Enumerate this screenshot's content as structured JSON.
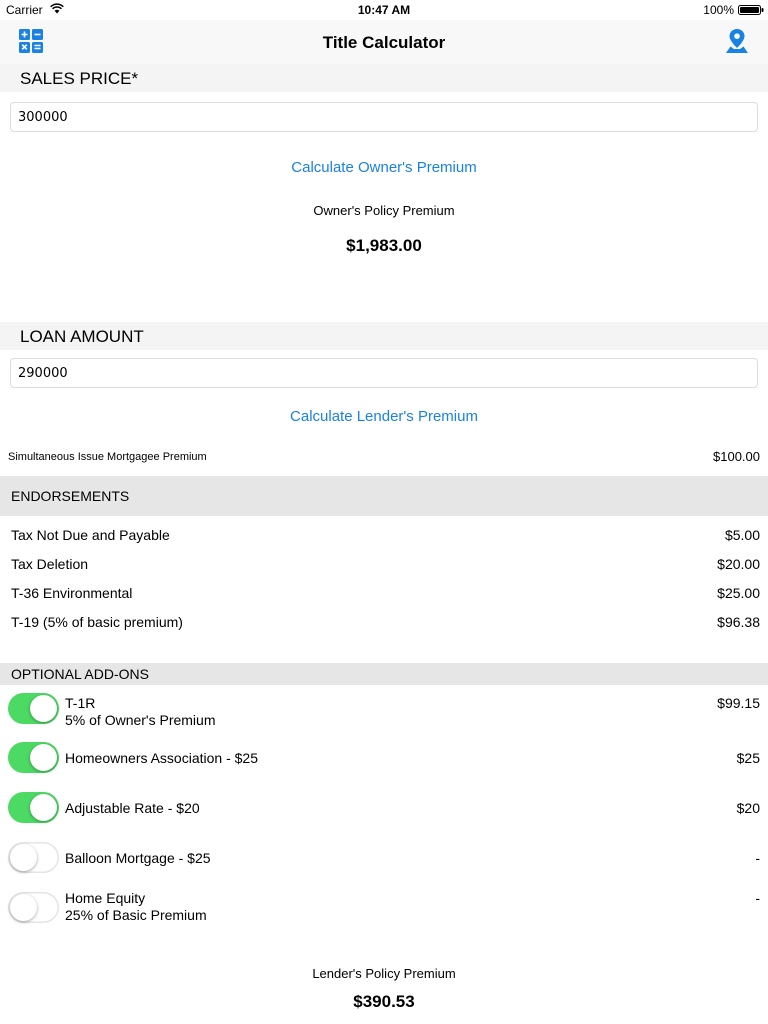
{
  "status_bar": {
    "carrier": "Carrier",
    "time": "10:47 AM",
    "battery": "100%"
  },
  "nav": {
    "title": "Title Calculator",
    "left_icon": "calculator-icon",
    "right_icon": "map-pin-icon",
    "accent": "#1a82e2"
  },
  "sales": {
    "header": "SALES PRICE*",
    "value": "300000",
    "calc_label": "Calculate Owner's Premium",
    "premium_label": "Owner's Policy Premium",
    "premium_value": "$1,983.00"
  },
  "loan": {
    "header": "LOAN AMOUNT",
    "value": "290000",
    "calc_label": "Calculate Lender's Premium",
    "simultaneous_label": "Simultaneous Issue Mortgagee Premium",
    "simultaneous_value": "$100.00"
  },
  "endorsements": {
    "header": "ENDORSEMENTS",
    "items": [
      {
        "label": "Tax Not Due and Payable",
        "value": "$5.00"
      },
      {
        "label": "Tax Deletion",
        "value": "$20.00"
      },
      {
        "label": "T-36 Environmental",
        "value": "$25.00"
      },
      {
        "label": "T-19 (5% of basic premium)",
        "value": "$96.38"
      }
    ]
  },
  "addons": {
    "header": "OPTIONAL ADD-ONS",
    "on_color": "#4cd964",
    "items": [
      {
        "title": "T-1R",
        "subtitle": "5% of Owner's Premium",
        "value": "$99.15",
        "enabled": true
      },
      {
        "title": "Homeowners Association - $25",
        "subtitle": "",
        "value": "$25",
        "enabled": true
      },
      {
        "title": "Adjustable Rate - $20",
        "subtitle": "",
        "value": "$20",
        "enabled": true
      },
      {
        "title": "Balloon Mortgage - $25",
        "subtitle": "",
        "value": "-",
        "enabled": false
      },
      {
        "title": "Home Equity",
        "subtitle": "25% of Basic Premium",
        "value": "-",
        "enabled": false
      }
    ]
  },
  "lender_total": {
    "label": "Lender's Policy Premium",
    "value": "$390.53"
  }
}
